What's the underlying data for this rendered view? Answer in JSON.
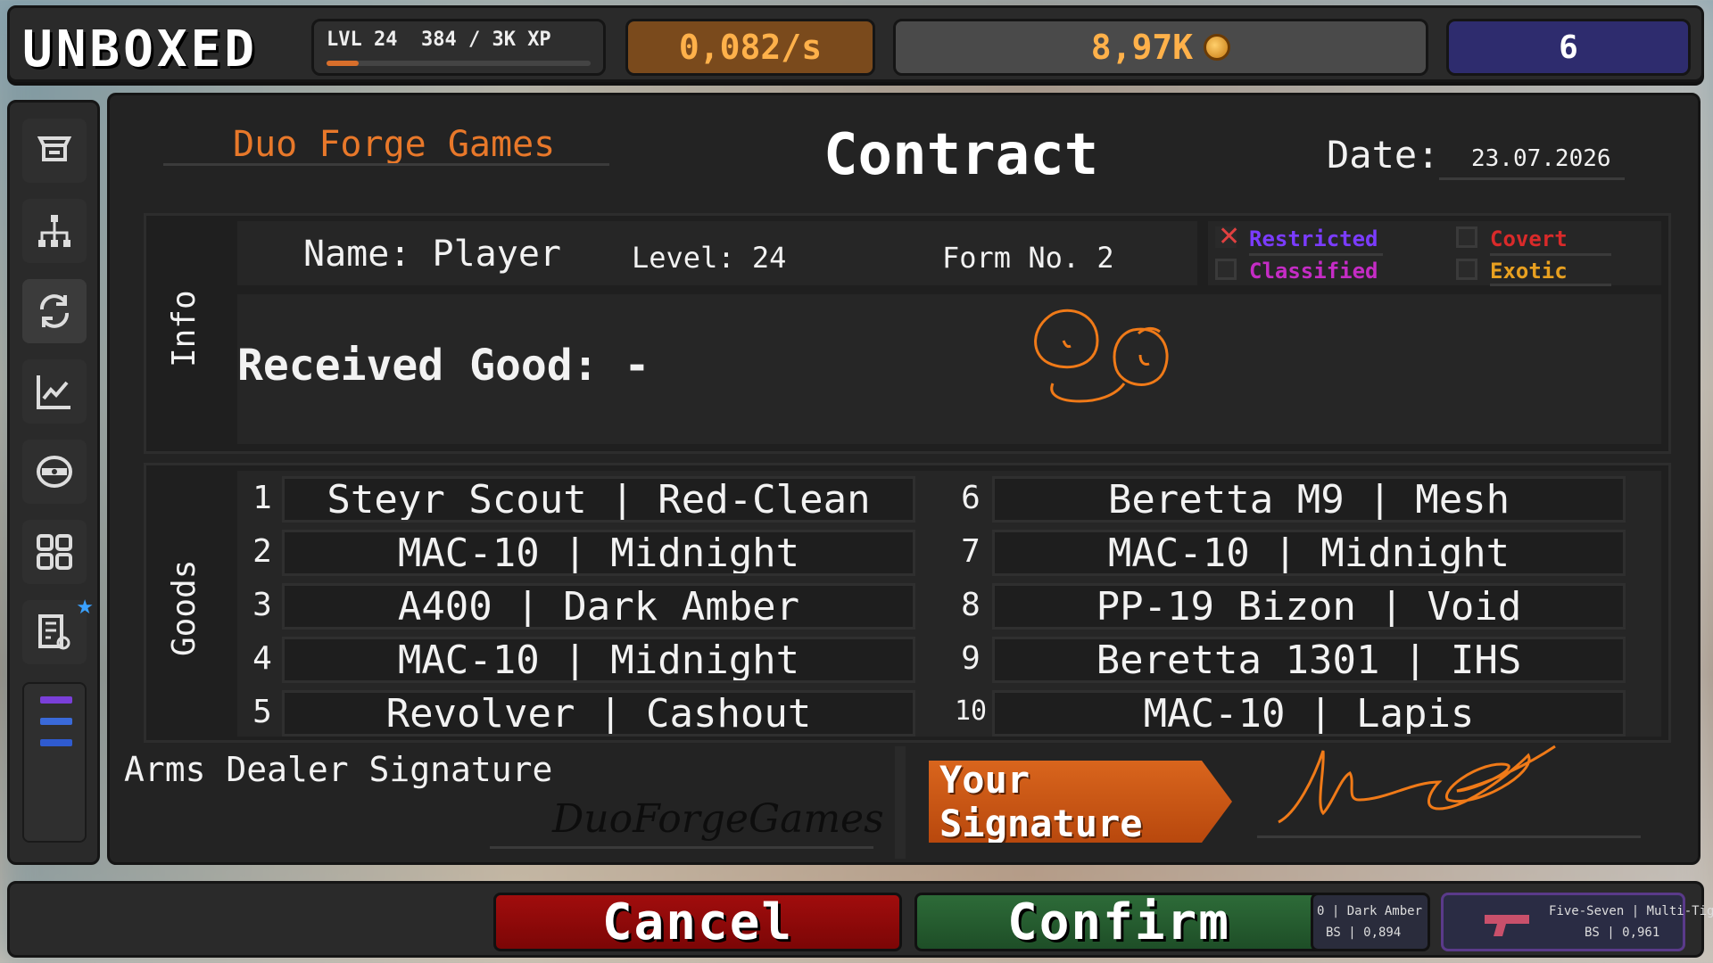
{
  "topbar": {
    "logo": "UNBOXED",
    "level_text": "LVL 24",
    "xp_text": "384 / 3K XP",
    "xp_progress": 0.12,
    "rate": "0,082/s",
    "coins": "8,97K",
    "gems": "6"
  },
  "sidebar": {
    "items": [
      {
        "icon": "cart-icon"
      },
      {
        "icon": "skill-tree-icon"
      },
      {
        "icon": "trade-up-icon",
        "active": true
      },
      {
        "icon": "stats-chart-icon"
      },
      {
        "icon": "case-icon"
      },
      {
        "icon": "inventory-grid-icon"
      },
      {
        "icon": "contracts-icon",
        "badge": "star"
      }
    ],
    "menu_colors": [
      "#7a3fd9",
      "#3a6ad9",
      "#2f5bd0"
    ]
  },
  "contract": {
    "company": "Duo Forge Games",
    "title": "Contract",
    "date_label": "Date:",
    "date_value": "23.07.2026",
    "info_label": "Info",
    "name": "Name: Player",
    "level": "Level: 24",
    "form": "Form No. 2",
    "received": "Received Good: -",
    "rarities": [
      {
        "label": "Restricted",
        "color": "#7b3cff",
        "checked": true
      },
      {
        "label": "Covert",
        "color": "#d92a2a",
        "checked": false
      },
      {
        "label": "Classified",
        "color": "#c52cc5",
        "checked": false
      },
      {
        "label": "Exotic",
        "color": "#e8a020",
        "checked": false
      }
    ],
    "goods_label": "Goods",
    "goods": [
      {
        "num": "1",
        "name": "Steyr Scout | Red-Clean"
      },
      {
        "num": "2",
        "name": "MAC-10 | Midnight"
      },
      {
        "num": "3",
        "name": "A400 | Dark Amber"
      },
      {
        "num": "4",
        "name": "MAC-10 | Midnight"
      },
      {
        "num": "5",
        "name": "Revolver | Cashout"
      },
      {
        "num": "6",
        "name": "Beretta M9 | Mesh"
      },
      {
        "num": "7",
        "name": "MAC-10 | Midnight"
      },
      {
        "num": "8",
        "name": "PP-19 Bizon | Void"
      },
      {
        "num": "9",
        "name": "Beretta 1301 | IHS"
      },
      {
        "num": "10",
        "name": "MAC-10 | Lapis"
      }
    ],
    "dealer_sig_label": "Arms Dealer Signature",
    "dealer_signature": "DuoForgeGames",
    "your_signature_button": "Your Signature"
  },
  "bottombar": {
    "cancel": "Cancel",
    "confirm": "Confirm",
    "recent_a_line1": "0 | Dark Amber",
    "recent_a_line2": "BS | 0,894",
    "recent_b_line1": "Five-Seven | Multi-Tiger",
    "recent_b_line2": "BS | 0,961"
  }
}
